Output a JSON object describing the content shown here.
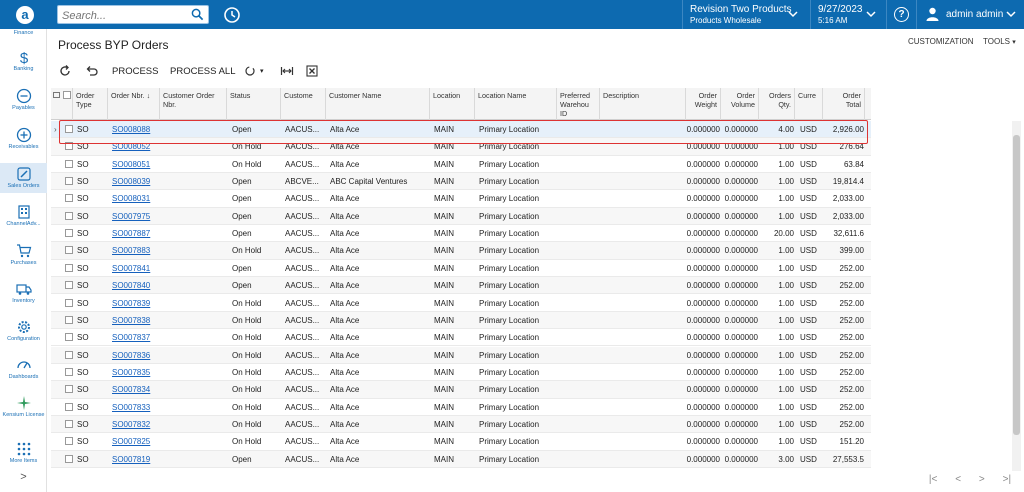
{
  "topbar": {
    "logo_letter": "a",
    "search_placeholder": "Search...",
    "tenant_name": "Revision Two Products",
    "tenant_sub": "Products Wholesale",
    "date": "9/27/2023",
    "time": "5:16 AM",
    "help": "?",
    "user": "admin admin"
  },
  "sidebar": {
    "items": [
      {
        "label": "Finance",
        "icon": "finance-icon"
      },
      {
        "label": "Banking",
        "icon": "dollar-icon"
      },
      {
        "label": "Payables",
        "icon": "minus-circle-icon"
      },
      {
        "label": "Receivables",
        "icon": "plus-circle-icon"
      },
      {
        "label": "Sales Orders",
        "icon": "pencil-icon"
      },
      {
        "label": "ChannelAdv...",
        "icon": "building-icon"
      },
      {
        "label": "Purchases",
        "icon": "cart-icon"
      },
      {
        "label": "Inventory",
        "icon": "truck-icon"
      },
      {
        "label": "Configuration",
        "icon": "gear-icon"
      },
      {
        "label": "Dashboards",
        "icon": "dashboard-icon"
      },
      {
        "label": "Kensium License",
        "icon": "kensium-icon"
      },
      {
        "label": "More Items",
        "icon": "grid-dots-icon"
      }
    ],
    "expand": ">"
  },
  "page": {
    "title": "Process BYP Orders",
    "customization": "CUSTOMIZATION",
    "tools": "TOOLS"
  },
  "toolbar": {
    "process": "PROCESS",
    "process_all": "PROCESS ALL"
  },
  "grid": {
    "headers": {
      "order_type": "Order Type",
      "order_nbr": "Order Nbr.",
      "customer_order_nbr": "Customer Order Nbr.",
      "status": "Status",
      "customer": "Custome",
      "customer_name": "Customer Name",
      "location": "Location",
      "location_name": "Location Name",
      "preferred_warehouse": "Preferred Warehou ID",
      "description": "Description",
      "order_weight": "Order Weight",
      "order_volume": "Order Volume",
      "orders_qty": "Orders Qty.",
      "currency": "Curre",
      "order_total": "Order Total"
    },
    "rows": [
      {
        "type": "SO",
        "nbr": "SO008088",
        "status": "Open",
        "customer": "AACUS...",
        "name": "Alta Ace",
        "loc": "MAIN",
        "locname": "Primary Location",
        "weight": "0.000000",
        "volume": "0.000000",
        "qty": "4.00",
        "cur": "USD",
        "total": "2,926.00"
      },
      {
        "type": "SO",
        "nbr": "SO008052",
        "status": "On Hold",
        "customer": "AACUS...",
        "name": "Alta Ace",
        "loc": "MAIN",
        "locname": "Primary Location",
        "weight": "0.000000",
        "volume": "0.000000",
        "qty": "1.00",
        "cur": "USD",
        "total": "276.64"
      },
      {
        "type": "SO",
        "nbr": "SO008051",
        "status": "On Hold",
        "customer": "AACUS...",
        "name": "Alta Ace",
        "loc": "MAIN",
        "locname": "Primary Location",
        "weight": "0.000000",
        "volume": "0.000000",
        "qty": "1.00",
        "cur": "USD",
        "total": "63.84"
      },
      {
        "type": "SO",
        "nbr": "SO008039",
        "status": "Open",
        "customer": "ABCVE...",
        "name": "ABC Capital Ventures",
        "loc": "MAIN",
        "locname": "Primary Location",
        "weight": "0.000000",
        "volume": "0.000000",
        "qty": "1.00",
        "cur": "USD",
        "total": "19,814.4"
      },
      {
        "type": "SO",
        "nbr": "SO008031",
        "status": "Open",
        "customer": "AACUS...",
        "name": "Alta Ace",
        "loc": "MAIN",
        "locname": "Primary Location",
        "weight": "0.000000",
        "volume": "0.000000",
        "qty": "1.00",
        "cur": "USD",
        "total": "2,033.00"
      },
      {
        "type": "SO",
        "nbr": "SO007975",
        "status": "Open",
        "customer": "AACUS...",
        "name": "Alta Ace",
        "loc": "MAIN",
        "locname": "Primary Location",
        "weight": "0.000000",
        "volume": "0.000000",
        "qty": "1.00",
        "cur": "USD",
        "total": "2,033.00"
      },
      {
        "type": "SO",
        "nbr": "SO007887",
        "status": "Open",
        "customer": "AACUS...",
        "name": "Alta Ace",
        "loc": "MAIN",
        "locname": "Primary Location",
        "weight": "0.000000",
        "volume": "0.000000",
        "qty": "20.00",
        "cur": "USD",
        "total": "32,611.6"
      },
      {
        "type": "SO",
        "nbr": "SO007883",
        "status": "On Hold",
        "customer": "AACUS...",
        "name": "Alta Ace",
        "loc": "MAIN",
        "locname": "Primary Location",
        "weight": "0.000000",
        "volume": "0.000000",
        "qty": "1.00",
        "cur": "USD",
        "total": "399.00"
      },
      {
        "type": "SO",
        "nbr": "SO007841",
        "status": "Open",
        "customer": "AACUS...",
        "name": "Alta Ace",
        "loc": "MAIN",
        "locname": "Primary Location",
        "weight": "0.000000",
        "volume": "0.000000",
        "qty": "1.00",
        "cur": "USD",
        "total": "252.00"
      },
      {
        "type": "SO",
        "nbr": "SO007840",
        "status": "Open",
        "customer": "AACUS...",
        "name": "Alta Ace",
        "loc": "MAIN",
        "locname": "Primary Location",
        "weight": "0.000000",
        "volume": "0.000000",
        "qty": "1.00",
        "cur": "USD",
        "total": "252.00"
      },
      {
        "type": "SO",
        "nbr": "SO007839",
        "status": "On Hold",
        "customer": "AACUS...",
        "name": "Alta Ace",
        "loc": "MAIN",
        "locname": "Primary Location",
        "weight": "0.000000",
        "volume": "0.000000",
        "qty": "1.00",
        "cur": "USD",
        "total": "252.00"
      },
      {
        "type": "SO",
        "nbr": "SO007838",
        "status": "On Hold",
        "customer": "AACUS...",
        "name": "Alta Ace",
        "loc": "MAIN",
        "locname": "Primary Location",
        "weight": "0.000000",
        "volume": "0.000000",
        "qty": "1.00",
        "cur": "USD",
        "total": "252.00"
      },
      {
        "type": "SO",
        "nbr": "SO007837",
        "status": "On Hold",
        "customer": "AACUS...",
        "name": "Alta Ace",
        "loc": "MAIN",
        "locname": "Primary Location",
        "weight": "0.000000",
        "volume": "0.000000",
        "qty": "1.00",
        "cur": "USD",
        "total": "252.00"
      },
      {
        "type": "SO",
        "nbr": "SO007836",
        "status": "On Hold",
        "customer": "AACUS...",
        "name": "Alta Ace",
        "loc": "MAIN",
        "locname": "Primary Location",
        "weight": "0.000000",
        "volume": "0.000000",
        "qty": "1.00",
        "cur": "USD",
        "total": "252.00"
      },
      {
        "type": "SO",
        "nbr": "SO007835",
        "status": "On Hold",
        "customer": "AACUS...",
        "name": "Alta Ace",
        "loc": "MAIN",
        "locname": "Primary Location",
        "weight": "0.000000",
        "volume": "0.000000",
        "qty": "1.00",
        "cur": "USD",
        "total": "252.00"
      },
      {
        "type": "SO",
        "nbr": "SO007834",
        "status": "On Hold",
        "customer": "AACUS...",
        "name": "Alta Ace",
        "loc": "MAIN",
        "locname": "Primary Location",
        "weight": "0.000000",
        "volume": "0.000000",
        "qty": "1.00",
        "cur": "USD",
        "total": "252.00"
      },
      {
        "type": "SO",
        "nbr": "SO007833",
        "status": "On Hold",
        "customer": "AACUS...",
        "name": "Alta Ace",
        "loc": "MAIN",
        "locname": "Primary Location",
        "weight": "0.000000",
        "volume": "0.000000",
        "qty": "1.00",
        "cur": "USD",
        "total": "252.00"
      },
      {
        "type": "SO",
        "nbr": "SO007832",
        "status": "On Hold",
        "customer": "AACUS...",
        "name": "Alta Ace",
        "loc": "MAIN",
        "locname": "Primary Location",
        "weight": "0.000000",
        "volume": "0.000000",
        "qty": "1.00",
        "cur": "USD",
        "total": "252.00"
      },
      {
        "type": "SO",
        "nbr": "SO007825",
        "status": "On Hold",
        "customer": "AACUS...",
        "name": "Alta Ace",
        "loc": "MAIN",
        "locname": "Primary Location",
        "weight": "0.000000",
        "volume": "0.000000",
        "qty": "1.00",
        "cur": "USD",
        "total": "151.20"
      },
      {
        "type": "SO",
        "nbr": "SO007819",
        "status": "Open",
        "customer": "AACUS...",
        "name": "Alta Ace",
        "loc": "MAIN",
        "locname": "Primary Location",
        "weight": "0.000000",
        "volume": "0.000000",
        "qty": "3.00",
        "cur": "USD",
        "total": "27,553.5"
      }
    ]
  },
  "colors": {
    "topbar": "#0d6ab0",
    "link": "#1560bd",
    "highlight": "#d33333"
  }
}
